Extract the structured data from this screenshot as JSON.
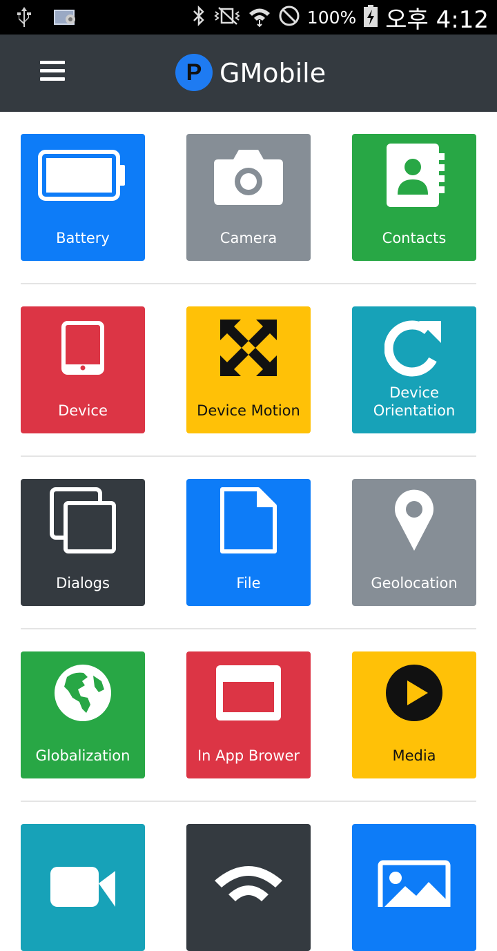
{
  "status_bar": {
    "battery_percent": "100%",
    "time": "오후 4:12"
  },
  "app_bar": {
    "logo_letter": "P",
    "title": "GMobile"
  },
  "tiles": [
    {
      "label": "Battery",
      "color": "#0d7cf8",
      "icon": "battery-icon"
    },
    {
      "label": "Camera",
      "color": "#868e96",
      "icon": "camera-icon"
    },
    {
      "label": "Contacts",
      "color": "#28a745",
      "icon": "contacts-icon"
    },
    {
      "label": "Device",
      "color": "#dc3545",
      "icon": "tablet-icon"
    },
    {
      "label": "Device Motion",
      "color": "#ffc107",
      "icon": "arrows-expand-icon"
    },
    {
      "label": "Device Orientation",
      "color": "#17a2b8",
      "icon": "rotate-icon"
    },
    {
      "label": "Dialogs",
      "color": "#343a40",
      "icon": "windows-icon"
    },
    {
      "label": "File",
      "color": "#0d7cf8",
      "icon": "file-icon"
    },
    {
      "label": "Geolocation",
      "color": "#868e96",
      "icon": "map-pin-icon"
    },
    {
      "label": "Globalization",
      "color": "#28a745",
      "icon": "globe-icon"
    },
    {
      "label": "In App Brower",
      "color": "#dc3545",
      "icon": "browser-window-icon"
    },
    {
      "label": "Media",
      "color": "#ffc107",
      "icon": "play-icon"
    },
    {
      "label": "",
      "color": "#17a2b8",
      "icon": "video-camera-icon"
    },
    {
      "label": "",
      "color": "#343a40",
      "icon": "wifi-icon"
    },
    {
      "label": "",
      "color": "#0d7cf8",
      "icon": "image-icon"
    }
  ]
}
